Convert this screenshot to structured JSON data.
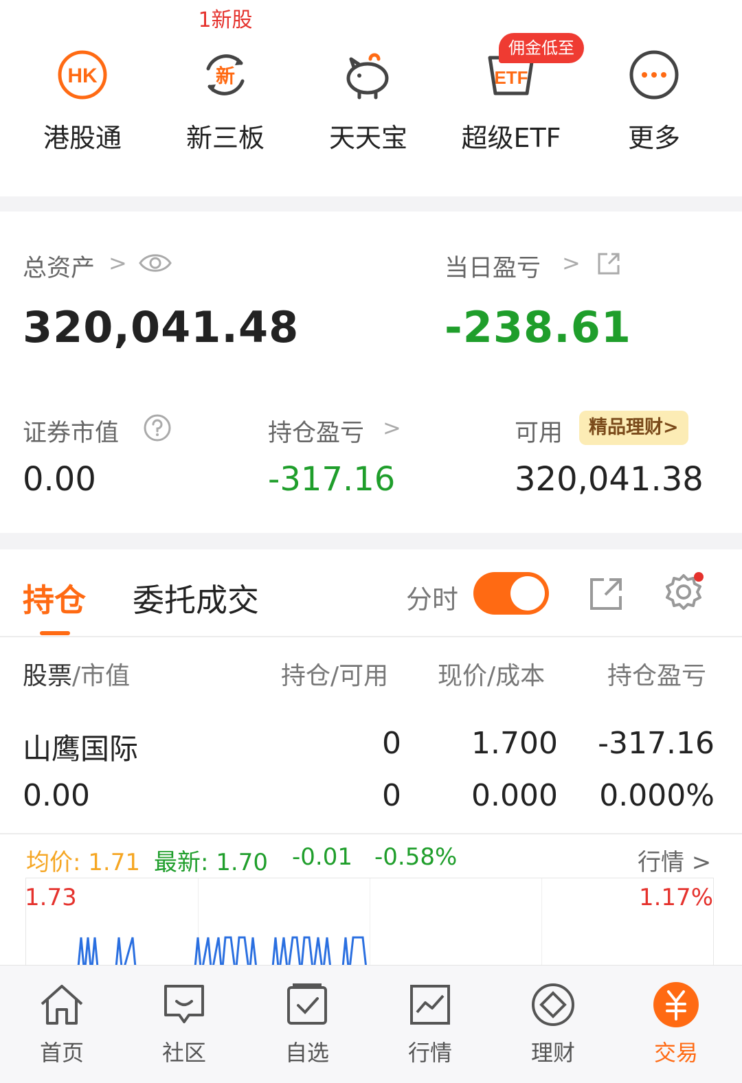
{
  "quick": {
    "items": [
      {
        "label": "港股通",
        "icon": "hk-icon",
        "icon_text": "HK"
      },
      {
        "label": "新三板",
        "icon": "new-board-icon",
        "icon_text": "新",
        "badge_top": "1新股"
      },
      {
        "label": "天天宝",
        "icon": "piggy-bank-icon"
      },
      {
        "label": "超级ETF",
        "icon": "etf-icon",
        "icon_text": "ETF",
        "promo": "佣金低至"
      },
      {
        "label": "更多",
        "icon": "more-icon"
      }
    ]
  },
  "assets": {
    "total_label": "总资产",
    "total_value": "320,041.48",
    "daily_pl_label": "当日盈亏",
    "daily_pl_value": "-238.61",
    "market_value_label": "证券市值",
    "market_value": "0.00",
    "position_pl_label": "持仓盈亏",
    "position_pl_value": "-317.16",
    "available_label": "可用",
    "available_value": "320,041.38",
    "finance_badge": "精品理财>"
  },
  "tabs": {
    "holdings": "持仓",
    "orders": "委托成交",
    "timeshare_label": "分时",
    "timeshare_on": true
  },
  "table": {
    "headers": {
      "stock_a": "股票",
      "stock_b": "/市值",
      "position": "持仓/可用",
      "price": "现价/成本",
      "pl": "持仓盈亏"
    },
    "rows": [
      {
        "name": "山鹰国际",
        "market_value": "0.00",
        "position": "0",
        "available": "0",
        "price": "1.700",
        "cost": "0.000",
        "pl": "-317.16",
        "pl_pct": "0.000%"
      }
    ]
  },
  "mini_quote": {
    "avg_label": "均价:",
    "avg_value": "1.71",
    "latest_label": "最新:",
    "latest_value": "1.70",
    "change": "-0.01",
    "change_pct": "-0.58%",
    "market_link": "行情 >",
    "high_price": "1.73",
    "high_pct": "1.17%"
  },
  "colors": {
    "accent": "#ff6a13",
    "up": "#e5322d",
    "down": "#1f9e2b",
    "avg": "#f5a623",
    "chart_line": "#2a6fe0"
  },
  "nav": {
    "items": [
      {
        "label": "首页",
        "icon": "home-icon"
      },
      {
        "label": "社区",
        "icon": "chat-icon"
      },
      {
        "label": "自选",
        "icon": "watchlist-icon"
      },
      {
        "label": "行情",
        "icon": "market-chart-icon"
      },
      {
        "label": "理财",
        "icon": "diamond-icon"
      },
      {
        "label": "交易",
        "icon": "yuan-icon",
        "active": true
      }
    ]
  }
}
